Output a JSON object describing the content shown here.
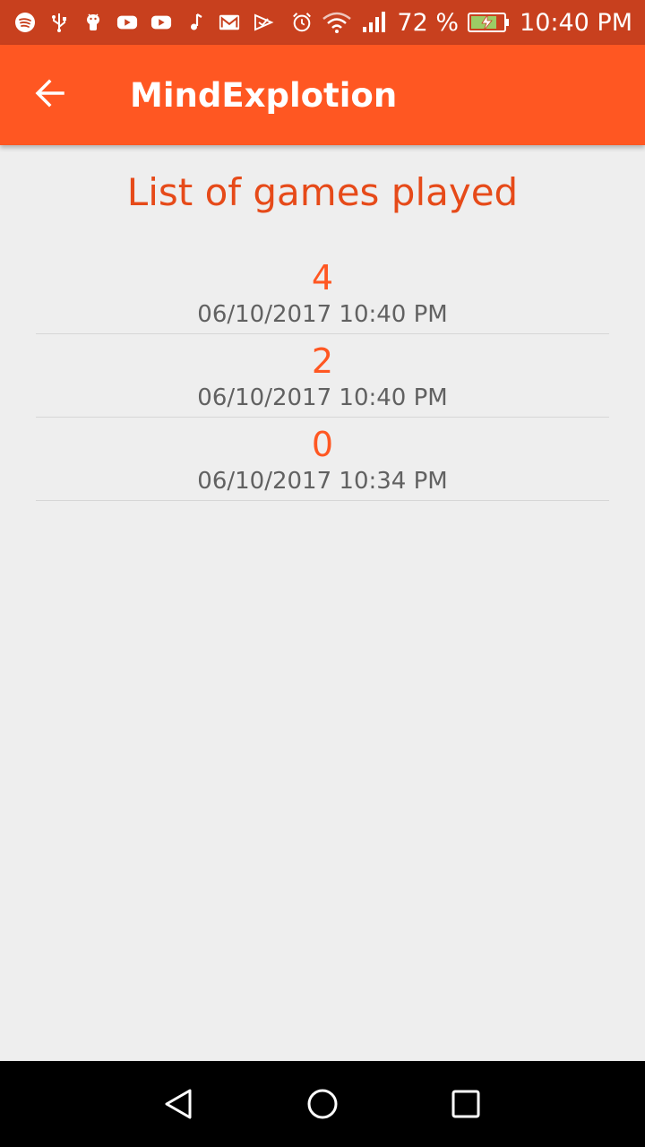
{
  "status_bar": {
    "battery_percent": "72 %",
    "time": "10:40 PM",
    "left_icons": [
      "spotify-icon",
      "usb-icon",
      "android-debug-icon",
      "youtube-icon",
      "youtube-icon",
      "music-note-icon",
      "gmail-icon",
      "play-store-icon"
    ],
    "right_icons": [
      "alarm-icon",
      "wifi-icon",
      "signal-icon",
      "battery-charging-icon"
    ]
  },
  "app_bar": {
    "title": "MindExplotion",
    "back_icon": "arrow-back-icon",
    "color": "#ff5722"
  },
  "main": {
    "title": "List of games played",
    "games": [
      {
        "score": "4",
        "date": "06/10/2017 10:40 PM"
      },
      {
        "score": "2",
        "date": "06/10/2017 10:40 PM"
      },
      {
        "score": "0",
        "date": "06/10/2017 10:34 PM"
      }
    ]
  },
  "nav_bar": {
    "buttons": [
      "back-nav-icon",
      "home-nav-icon",
      "recents-nav-icon"
    ]
  }
}
